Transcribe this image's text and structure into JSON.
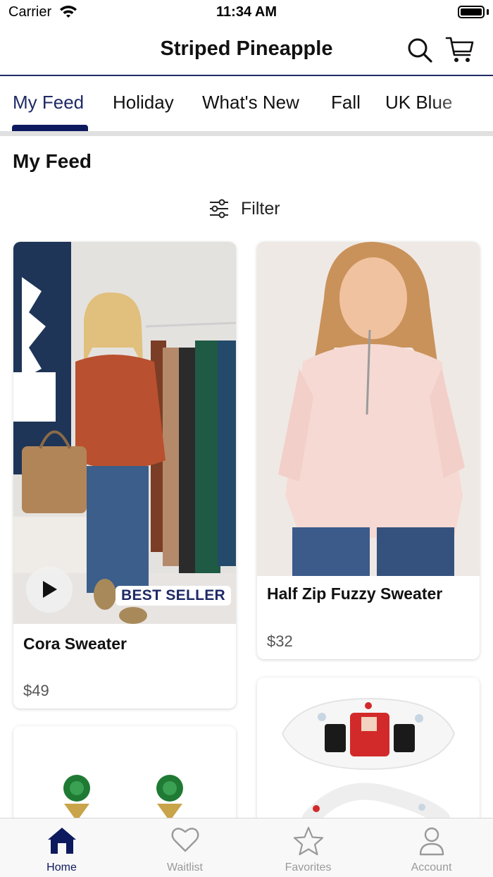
{
  "status_bar": {
    "carrier": "Carrier",
    "time": "11:34 AM"
  },
  "header": {
    "title": "Striped Pineapple"
  },
  "tabs": [
    {
      "label": "My Feed",
      "active": true
    },
    {
      "label": "Holiday"
    },
    {
      "label": "What's New"
    },
    {
      "label": "Fall"
    },
    {
      "label": "UK Blue"
    }
  ],
  "section_title": "My Feed",
  "filter_label": "Filter",
  "products": [
    {
      "name": "Cora Sweater",
      "price": "$49",
      "badge": "BEST SELLER",
      "has_video": true
    },
    {
      "name": "Half Zip Fuzzy Sweater",
      "price": "$32"
    }
  ],
  "tabbar": [
    {
      "label": "Home",
      "icon": "home-icon",
      "active": true
    },
    {
      "label": "Waitlist",
      "icon": "heart-icon"
    },
    {
      "label": "Favorites",
      "icon": "star-icon"
    },
    {
      "label": "Account",
      "icon": "person-icon"
    }
  ],
  "colors": {
    "accent": "#0d1a5e",
    "badge_text": "#1f2a66",
    "inactive": "#9a9a9a"
  }
}
